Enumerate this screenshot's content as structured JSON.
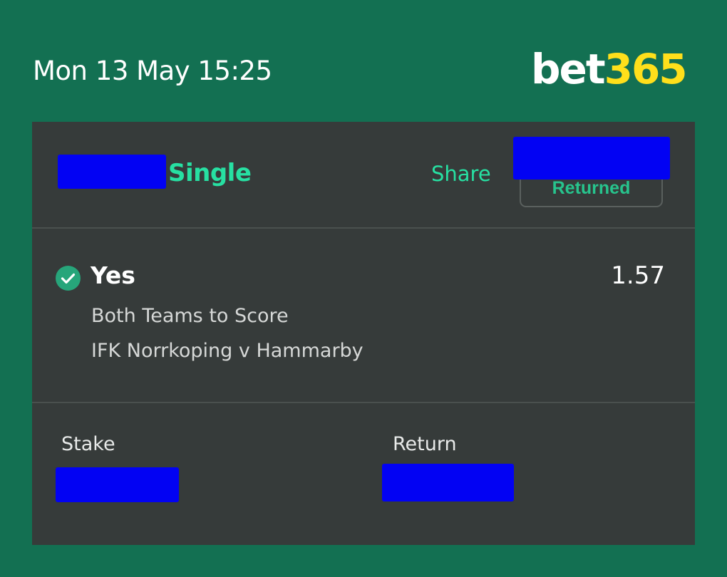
{
  "header": {
    "datetime": "Mon 13 May 15:25",
    "brand": {
      "part1": "bet",
      "part2": "365"
    }
  },
  "slip": {
    "bet_type": "Single",
    "share_label": "Share",
    "status": "Returned",
    "selection": {
      "name": "Yes",
      "odds": "1.57",
      "market": "Both Teams to Score",
      "event": "IFK Norrkoping v Hammarby"
    },
    "stake_label": "Stake",
    "return_label": "Return"
  },
  "colors": {
    "page_background": "#137052",
    "card_background": "#363b3a",
    "accent_green": "#27e0a2",
    "brand_yellow": "#ffdf1b",
    "redaction_blue": "#0202f3"
  },
  "icons": {
    "selection_status": "check-circle-icon"
  }
}
